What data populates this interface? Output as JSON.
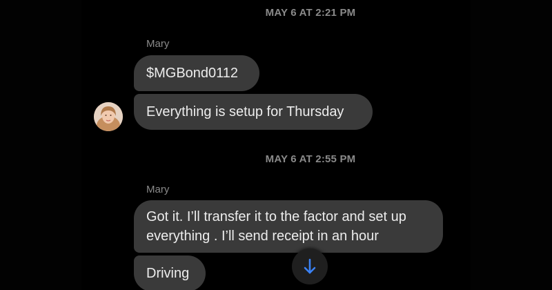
{
  "conversation": {
    "timestamp_1": "MAY 6 AT 2:21 PM",
    "timestamp_2": "MAY 6 AT 2:55 PM",
    "sender_1": "Mary",
    "sender_2": "Mary",
    "messages_group_1": [
      {
        "text": "$MGBond0112"
      },
      {
        "text": "Everything is setup for Thursday"
      }
    ],
    "messages_group_2": [
      {
        "line_1": "Got it. I’ll transfer it to the factor and set up",
        "line_2": "everything . I’ll send receipt in an hour"
      },
      {
        "text": "Driving"
      }
    ]
  },
  "icons": {
    "avatar": "profile-photo",
    "scroll_button": "arrow-down-icon"
  },
  "colors": {
    "background": "#000000",
    "bubble": "#3a3a3a",
    "bubble_text": "#ededed",
    "meta_text": "#8a8a8a",
    "scroll_arrow": "#3b82f6"
  }
}
